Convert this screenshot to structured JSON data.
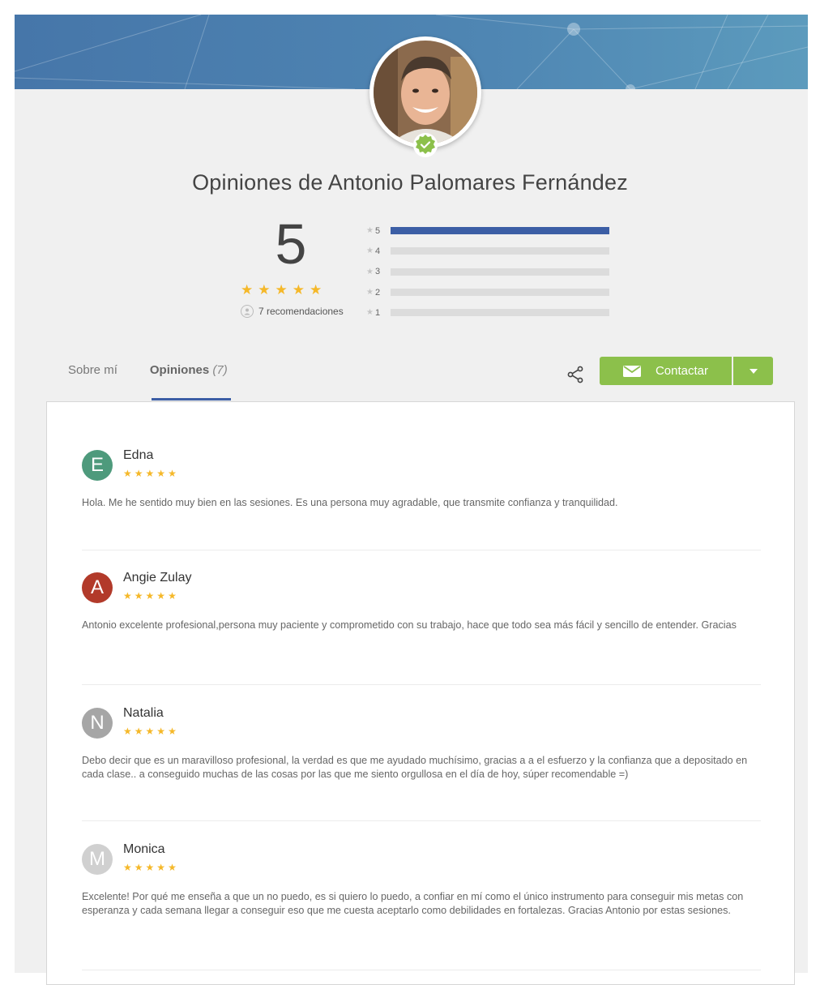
{
  "profile": {
    "title": "Opiniones de Antonio Palomares Fernández",
    "score": "5",
    "recommendations": "7 recomendaciones"
  },
  "distribution": [
    {
      "label": "5",
      "fraction": 1.0
    },
    {
      "label": "4",
      "fraction": 0.0
    },
    {
      "label": "3",
      "fraction": 0.0
    },
    {
      "label": "2",
      "fraction": 0.0
    },
    {
      "label": "1",
      "fraction": 0.0
    }
  ],
  "tabs": {
    "about": "Sobre mí",
    "reviews": "Opiniones",
    "reviews_count": "(7)"
  },
  "actions": {
    "contact_label": "Contactar"
  },
  "colors": {
    "accent_blue": "#3c5ea5",
    "contact_green": "#8cc04b",
    "star_yellow": "#f5b829"
  },
  "reviews": [
    {
      "initial": "E",
      "name": "Edna",
      "rating": 5,
      "avatar_color": "#4e9a7c",
      "text": "Hola. Me he sentido muy bien en las sesiones. Es una persona muy agradable, que transmite confianza y tranquilidad."
    },
    {
      "initial": "A",
      "name": "Angie Zulay",
      "rating": 5,
      "avatar_color": "#b23a2a",
      "text": "Antonio excelente profesional,persona muy paciente y comprometido con su trabajo, hace que todo sea más fácil y sencillo de entender. Gracias"
    },
    {
      "initial": "N",
      "name": "Natalia",
      "rating": 5,
      "avatar_color": "#a6a6a6",
      "text": "Debo decir que es un maravilloso profesional, la verdad es que me ayudado muchísimo, gracias a a el esfuerzo y la confianza que a depositado en cada clase.. a conseguido muchas de las cosas por las que me siento orgullosa en el día de hoy, súper recomendable =)"
    },
    {
      "initial": "M",
      "name": "Monica",
      "rating": 5,
      "avatar_color": "#d0d0d0",
      "text": "Excelente! Por qué me enseña a que un no puedo, es si quiero lo puedo, a confiar en mí como el único instrumento para conseguir mis metas con esperanza y cada semana llegar a conseguir eso que me cuesta aceptarlo como debilidades en fortalezas. Gracias Antonio por estas sesiones."
    }
  ]
}
